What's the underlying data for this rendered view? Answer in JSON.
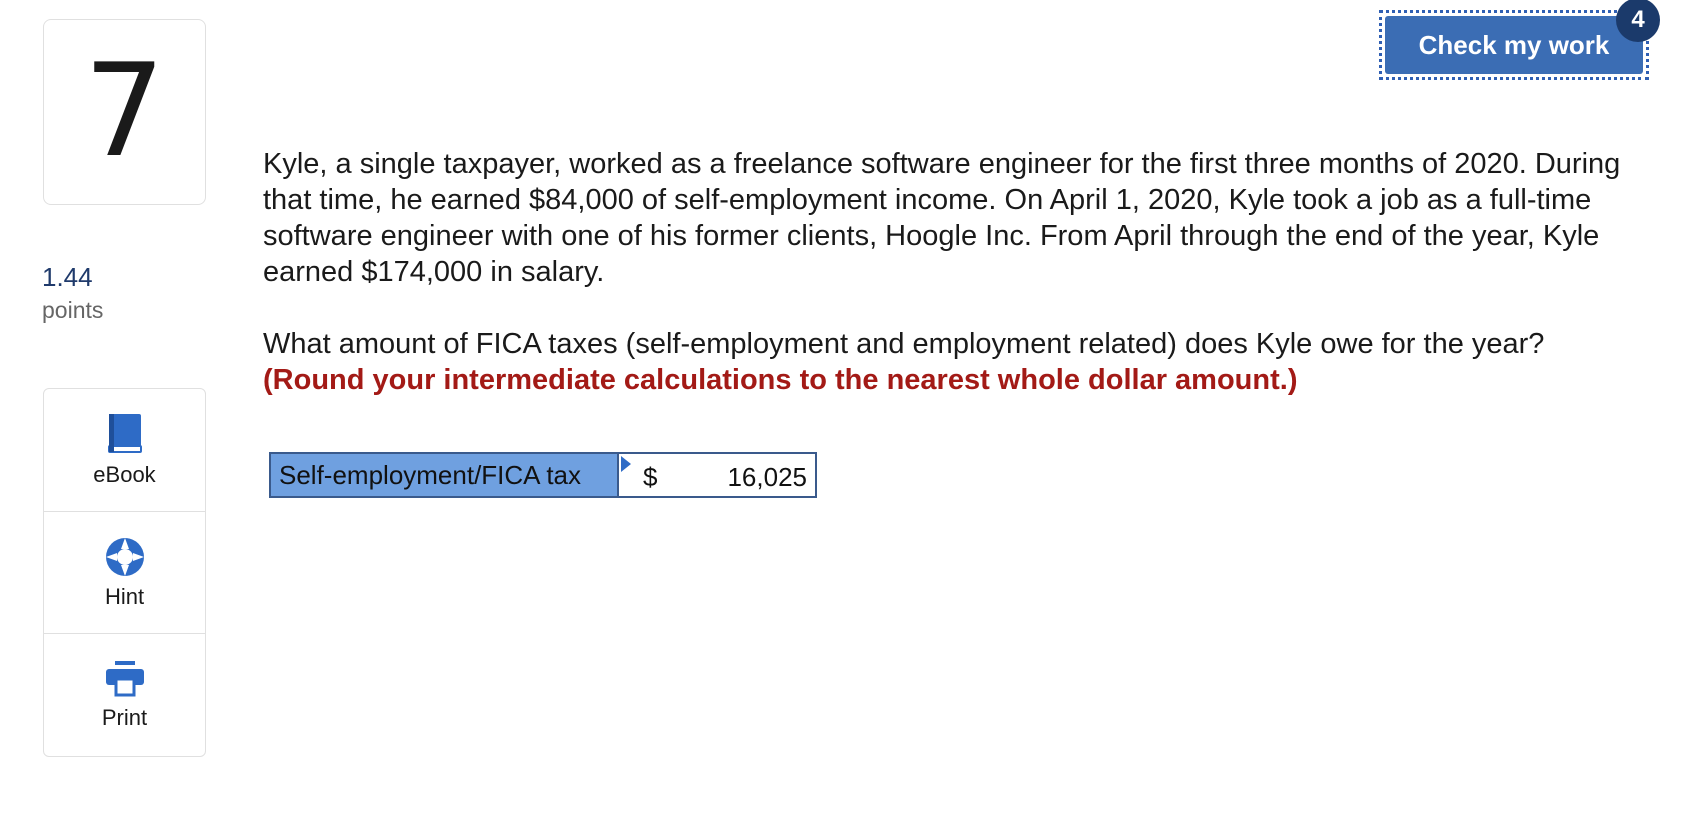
{
  "question": {
    "number": "7",
    "points_value": "1.44",
    "points_label": "points",
    "paragraph": "Kyle, a single taxpayer, worked as a freelance software engineer for the first three months of 2020. During that time, he earned $84,000 of self-employment income. On April 1, 2020, Kyle took a job as a full-time software engineer with one of his former clients, Hoogle Inc. From April through the end of the year, Kyle earned $174,000 in salary.",
    "prompt": "What amount of FICA taxes (self-employment and employment related) does Kyle owe for the year?",
    "instruction": "(Round your intermediate calculations to the nearest whole dollar amount.)"
  },
  "tools": [
    {
      "label": "eBook",
      "icon": "book-icon"
    },
    {
      "label": "Hint",
      "icon": "lifebuoy-icon"
    },
    {
      "label": "Print",
      "icon": "printer-icon"
    }
  ],
  "header": {
    "check_label": "Check my work",
    "check_count": "4"
  },
  "answer": {
    "label": "Self-employment/FICA tax",
    "currency": "$",
    "value": "16,025"
  },
  "colors": {
    "accent": "#3b6db4",
    "badge": "#1b3a6b",
    "instruction": "#a31a16",
    "label_cell": "#6fa0e0"
  }
}
